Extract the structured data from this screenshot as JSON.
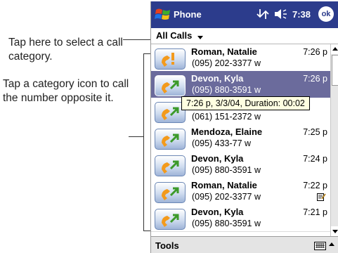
{
  "callouts": [
    "Tap here to select a call category.",
    "Tap a category icon to call the number opposite it."
  ],
  "titlebar": {
    "title": "Phone",
    "time": "7:38",
    "ok_label": "ok"
  },
  "filter": {
    "label": "All Calls"
  },
  "calls": [
    {
      "name": "Roman, Natalie",
      "time": "7:26 p",
      "number": "(095) 202-3377 w",
      "type": "missed",
      "selected": false,
      "note": false
    },
    {
      "name": "Devon, Kyla",
      "time": "7:26 p",
      "number": "(095) 880-3591 w",
      "type": "outgoing",
      "selected": true,
      "note": false
    },
    {
      "name": "",
      "time": "",
      "number": "(061) 151-2372 w",
      "type": "outgoing",
      "selected": false,
      "note": false
    },
    {
      "name": "Mendoza, Elaine",
      "time": "7:25 p",
      "number": "(095) 433-77 w",
      "type": "outgoing",
      "selected": false,
      "note": false
    },
    {
      "name": "Devon, Kyla",
      "time": "7:24 p",
      "number": "(095) 880-3591 w",
      "type": "outgoing",
      "selected": false,
      "note": false
    },
    {
      "name": "Roman, Natalie",
      "time": "7:22 p",
      "number": "(095) 202-3377 w",
      "type": "outgoing",
      "selected": false,
      "note": true
    },
    {
      "name": "Devon, Kyla",
      "time": "7:21 p",
      "number": "(095) 880-3591 w",
      "type": "outgoing",
      "selected": false,
      "note": false
    }
  ],
  "tooltip": "7:26 p, 3/3/04, Duration: 00:02",
  "menubar": {
    "tools_label": "Tools"
  },
  "icons": {
    "missed": "missed-call-icon",
    "outgoing": "outgoing-call-icon",
    "note": "note-icon",
    "keyboard": "keyboard-icon"
  },
  "colors": {
    "titlebar": "#2c3c8c",
    "selected_row": "#6b6b9c",
    "tooltip": "#ffffe1"
  }
}
